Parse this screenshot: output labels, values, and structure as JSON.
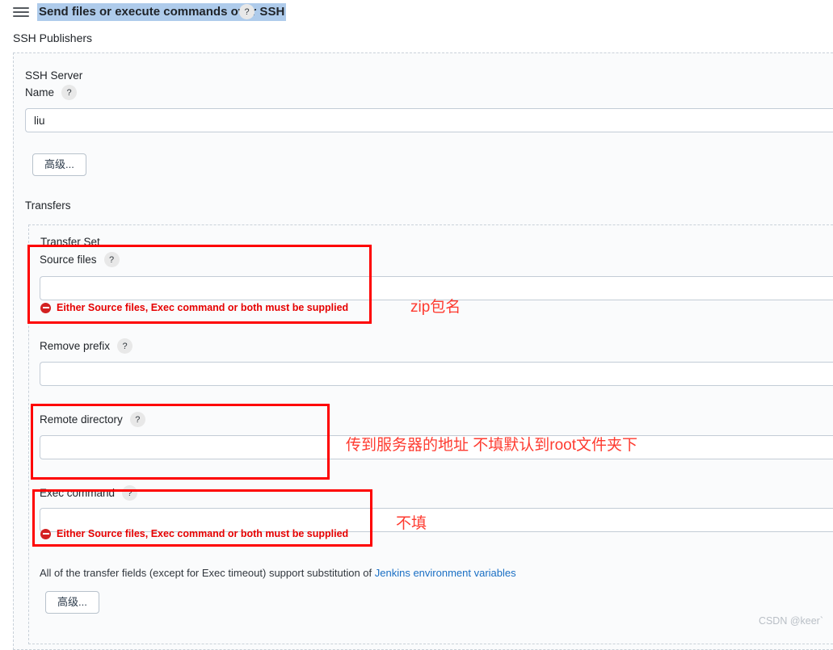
{
  "topbar": {
    "menu_icon": "hamburger-icon",
    "title": "Send files or execute commands over SSH",
    "help_label": "?"
  },
  "section": {
    "title": "SSH Publishers"
  },
  "ssh_server": {
    "group_label_line1": "SSH Server",
    "name_label": "Name",
    "name_help": "?",
    "name_value": "liu",
    "advanced_button": "高级..."
  },
  "transfers": {
    "heading": "Transfers",
    "transfer_set_legend": "Transfer Set",
    "fields": [
      {
        "label": "Source files",
        "help": "?",
        "value": "",
        "error": "Either Source files, Exec command or both must be supplied"
      },
      {
        "label": "Remove prefix",
        "help": "?",
        "value": "",
        "error": ""
      },
      {
        "label": "Remote directory",
        "help": "?",
        "value": "",
        "error": ""
      },
      {
        "label": "Exec command",
        "help": "?",
        "value": "",
        "error": "Either Source files, Exec command or both must be supplied"
      }
    ],
    "note_prefix": "All of the transfer fields (except for Exec timeout) support substitution of ",
    "note_link": "Jenkins environment variables",
    "advanced_button": "高级..."
  },
  "annotations": [
    {
      "text": "zip包名"
    },
    {
      "text": "传到服务器的地址 不填默认到root文件夹下"
    },
    {
      "text": "不填"
    }
  ],
  "watermark": "CSDN @keer`",
  "colors": {
    "annotation_red": "#fe3b30",
    "box_red": "#fe0000",
    "error_red": "#e60000",
    "link_blue": "#1a6fc4",
    "highlight_blue": "#aecbeb"
  }
}
